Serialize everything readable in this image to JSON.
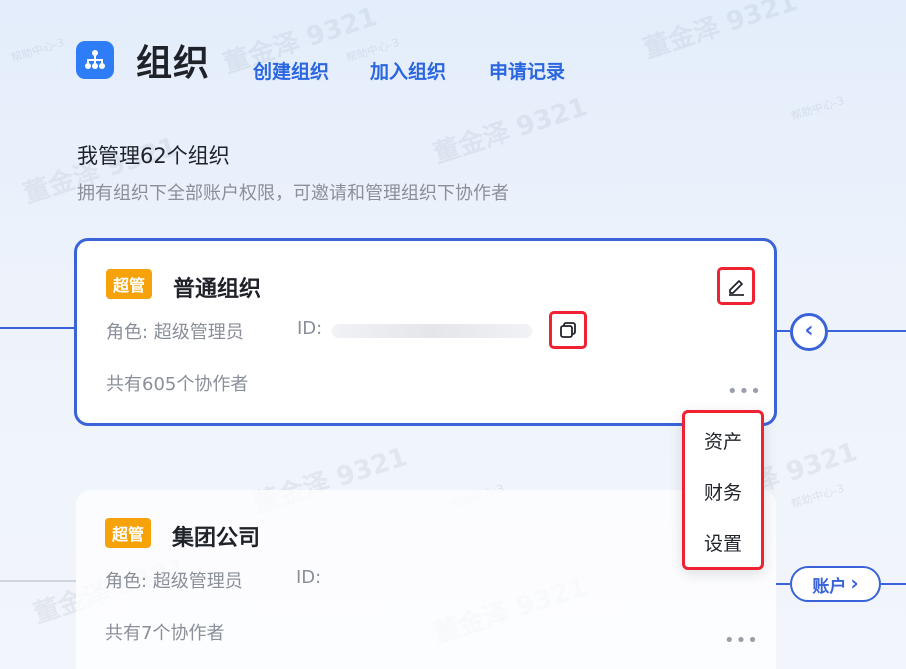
{
  "header": {
    "title": "组织",
    "links": [
      "创建组织",
      "加入组织",
      "申请记录"
    ]
  },
  "section": {
    "title": "我管理62个组织",
    "description": "拥有组织下全部账户权限，可邀请和管理组织下协作者"
  },
  "orgs": [
    {
      "badge": "超管",
      "name": "普通组织",
      "role": "角色: 超级管理员",
      "id_label": "ID:",
      "collaborators": "共有605个协作者",
      "more": "•••"
    },
    {
      "badge": "超管",
      "name": "集团公司",
      "role": "角色: 超级管理员",
      "id_label": "ID:",
      "collaborators": "共有7个协作者",
      "more": "•••"
    }
  ],
  "menu": {
    "items": [
      "资产",
      "财务",
      "设置"
    ]
  },
  "account_button": {
    "label": "账户",
    "chevron": "›"
  },
  "collapse_button": {
    "chevron": "‹"
  },
  "watermark": {
    "name": "董金泽 9321",
    "small": "帮助中心-3"
  },
  "icons": {
    "logo": "org-tree-icon",
    "edit": "pencil-icon",
    "copy": "copy-icon"
  },
  "colors": {
    "brand": "#2f7df6",
    "link": "#2a66e0",
    "active_border": "#3b63d9",
    "badge": "#f5a20b",
    "highlight": "#ee2233"
  }
}
